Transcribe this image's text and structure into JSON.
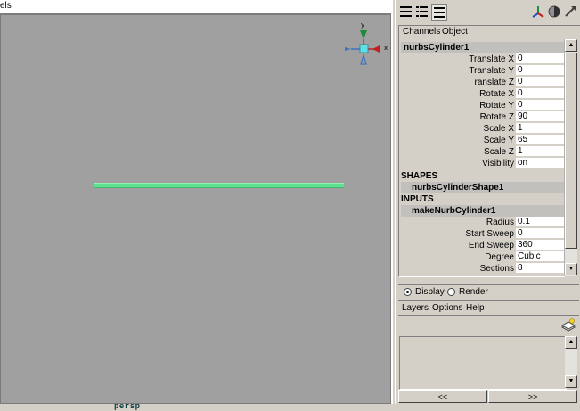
{
  "viewport": {
    "menu_fragment": "els",
    "camera_label": "persp",
    "axis_labels": {
      "y": "y",
      "x": "x"
    }
  },
  "channel_box": {
    "menu": [
      "Channels",
      "Object"
    ],
    "node_name": "nurbsCylinder1",
    "transform_attrs": [
      {
        "name": "Translate X",
        "value": "0"
      },
      {
        "name": "Translate Y",
        "value": "0"
      },
      {
        "name": "ranslate Z",
        "value": "0"
      },
      {
        "name": "Rotate X",
        "value": "0"
      },
      {
        "name": "Rotate Y",
        "value": "0"
      },
      {
        "name": "Rotate Z",
        "value": "90"
      },
      {
        "name": "Scale X",
        "value": "1"
      },
      {
        "name": "Scale Y",
        "value": "65"
      },
      {
        "name": "Scale Z",
        "value": "1"
      },
      {
        "name": "Visibility",
        "value": "on"
      }
    ],
    "shapes_label": "SHAPES",
    "shape_name": "nurbsCylinderShape1",
    "inputs_label": "INPUTS",
    "input_name": "makeNurbCylinder1",
    "input_attrs": [
      {
        "name": "Radius",
        "value": "0.1"
      },
      {
        "name": "Start Sweep",
        "value": "0"
      },
      {
        "name": "End Sweep",
        "value": "360"
      },
      {
        "name": "Degree",
        "value": "Cubic"
      },
      {
        "name": "Sections",
        "value": "8"
      }
    ]
  },
  "layer_editor": {
    "display_label": "Display",
    "render_label": "Render",
    "selected_mode": "Display",
    "menu": [
      "Layers",
      "Options",
      "Help"
    ],
    "nav_prev": "<<",
    "nav_next": ">>"
  },
  "colors": {
    "viewport_bg": "#a0a0a0",
    "object_highlight": "#5fe28f",
    "panel_bg": "#d4d0c8"
  }
}
